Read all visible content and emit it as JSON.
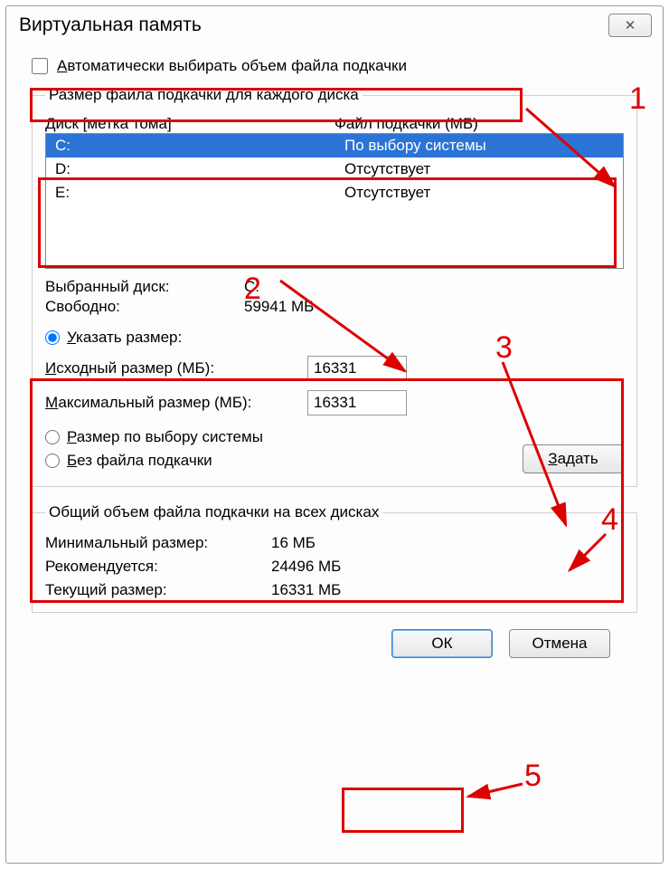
{
  "window": {
    "title": "Виртуальная память"
  },
  "auto_checkbox": {
    "label_plain": "Автоматически выбирать объем файла подкачки",
    "checked": false
  },
  "drives_group": {
    "legend": "Размер файла подкачки для каждого диска",
    "header_drive": "Диск [метка тома]",
    "header_file": "Файл подкачки (МБ)",
    "rows": [
      {
        "drive": "C:",
        "status": "По выбору системы",
        "selected": true
      },
      {
        "drive": "D:",
        "status": "Отсутствует",
        "selected": false
      },
      {
        "drive": "E:",
        "status": "Отсутствует",
        "selected": false
      }
    ],
    "selected_drive_label": "Выбранный диск:",
    "selected_drive_value": "C:",
    "free_label": "Свободно:",
    "free_value": "59941 МБ",
    "radio_custom": "Указать размер:",
    "initial_label": "Исходный размер (МБ):",
    "initial_value": "16331",
    "max_label": "Максимальный размер (МБ):",
    "max_value": "16331",
    "radio_system": "Размер по выбору системы",
    "radio_none": "Без файла подкачки",
    "set_button": "Задать"
  },
  "total_group": {
    "legend": "Общий объем файла подкачки на всех дисках",
    "min_label": "Минимальный размер:",
    "min_value": "16 МБ",
    "rec_label": "Рекомендуется:",
    "rec_value": "24496 МБ",
    "cur_label": "Текущий размер:",
    "cur_value": "16331 МБ"
  },
  "buttons": {
    "ok": "ОК",
    "cancel": "Отмена"
  },
  "annotations": {
    "n1": "1",
    "n2": "2",
    "n3": "3",
    "n4": "4",
    "n5": "5"
  }
}
